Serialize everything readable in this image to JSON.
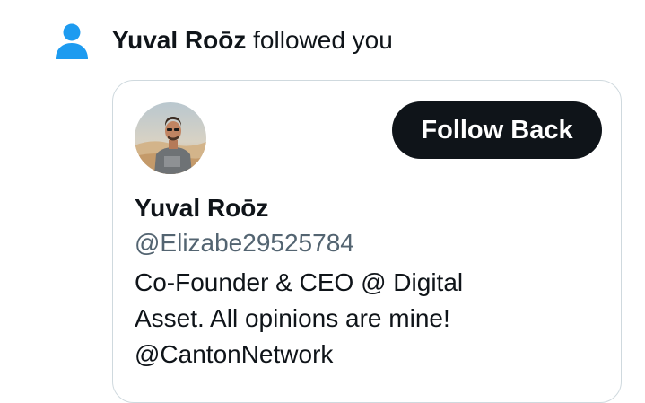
{
  "notification": {
    "user_name": "Yuval Roōz",
    "action_text": " followed you",
    "icon": "person-icon",
    "icon_color": "#1d9bf0"
  },
  "profile_card": {
    "avatar": "profile-photo",
    "follow_back_label": "Follow Back",
    "display_name": "Yuval Roōz",
    "handle": "@Elizabe29525784",
    "bio_lines": [
      "Co-Founder & CEO @ Digital",
      "Asset. All opinions are mine!",
      "@CantonNetwork"
    ]
  },
  "colors": {
    "text": "#0f1419",
    "secondary_text": "#536471",
    "border": "#cfd9de",
    "button_bg": "#0f1419",
    "button_text": "#ffffff"
  }
}
